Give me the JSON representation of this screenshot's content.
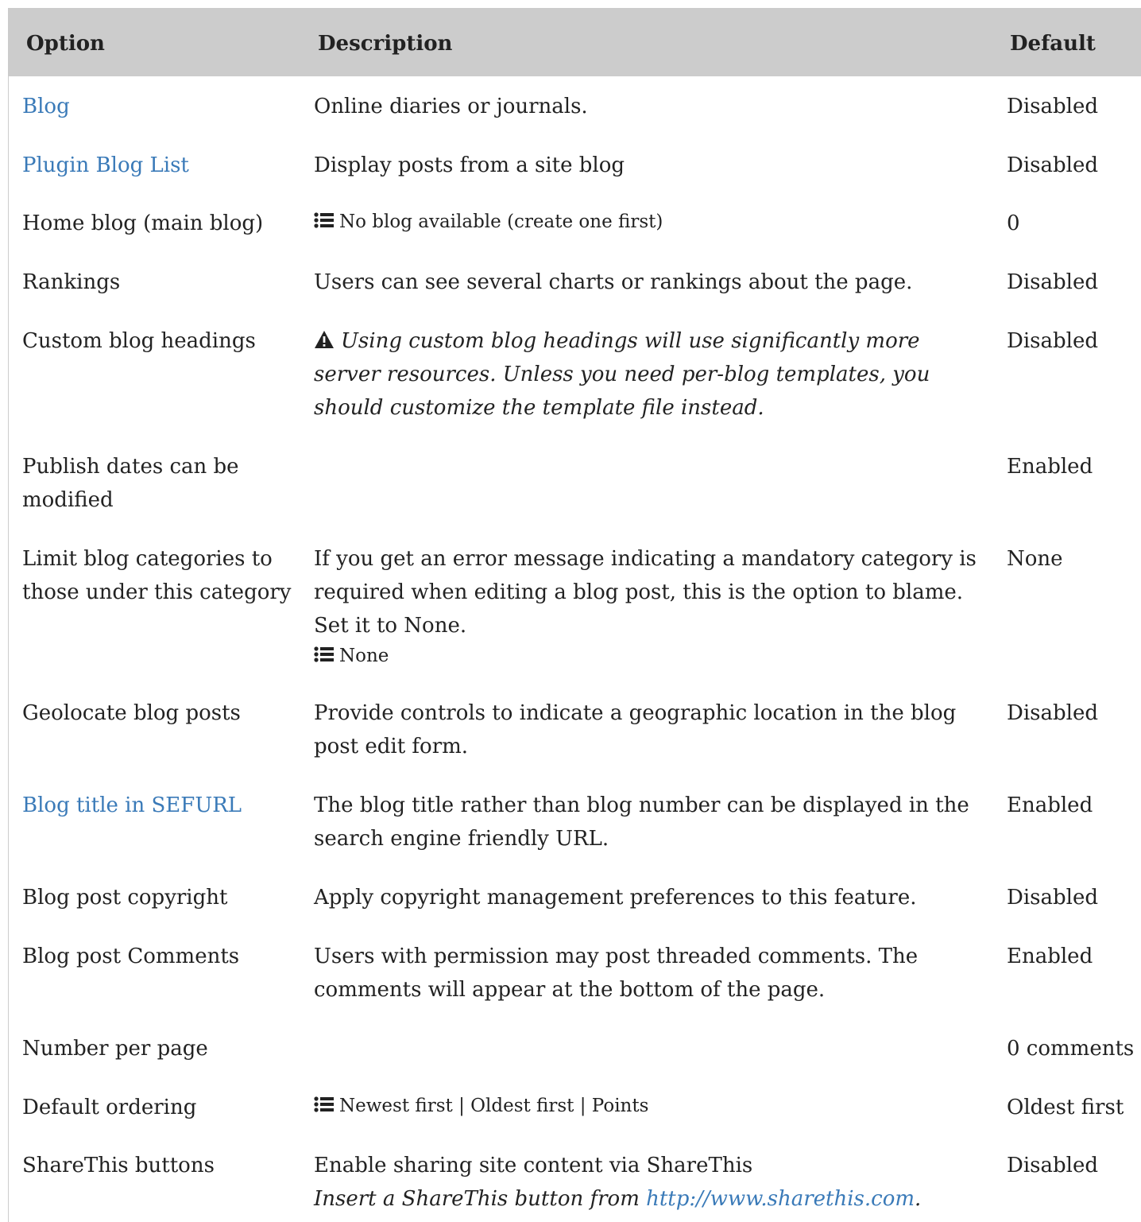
{
  "header": {
    "option": "Option",
    "description": "Description",
    "default": "Default"
  },
  "rows": [
    {
      "option": "Blog",
      "option_is_link": true,
      "description": "Online diaries or journals.",
      "default": "Disabled"
    },
    {
      "option": "Plugin Blog List",
      "option_is_link": true,
      "description": "Display posts from a site blog",
      "default": "Disabled"
    },
    {
      "option": "Home blog (main blog)",
      "description_list_icon": "list-icon",
      "description": "No blog available (create one first)",
      "default": "0"
    },
    {
      "option": "Rankings",
      "description": "Users can see several charts or rankings about the page.",
      "default": "Disabled"
    },
    {
      "option": "Custom blog headings",
      "description_warning_icon": "warning-icon",
      "description": "Using custom blog headings will use significantly more server resources. Unless you need per-blog templates, you should customize the template file instead.",
      "default": "Disabled"
    },
    {
      "option": "Publish dates can be modified",
      "description": "",
      "default": "Enabled"
    },
    {
      "option": "Limit blog categories to those under this category",
      "description": "If you get an error message indicating a mandatory category is required when editing a blog post, this is the option to blame. Set it to None.",
      "description_choices": "None",
      "default": "None"
    },
    {
      "option": "Geolocate blog posts",
      "description": "Provide controls to indicate a geographic location in the blog post edit form.",
      "default": "Disabled"
    },
    {
      "option": "Blog title in SEFURL",
      "option_is_link": true,
      "description": "The blog title rather than blog number can be displayed in the search engine friendly URL.",
      "default": "Enabled"
    },
    {
      "option": "Blog post copyright",
      "description": "Apply copyright management preferences to this feature.",
      "default": "Disabled"
    },
    {
      "option": "Blog post Comments",
      "description": "Users with permission may post threaded comments. The comments will appear at the bottom of the page.",
      "default": "Enabled"
    },
    {
      "option": "Number per page",
      "description": "",
      "default": "0 comments"
    },
    {
      "option": "Default ordering",
      "description_list_icon": "list-icon",
      "description": "Newest first | Oldest first | Points",
      "default": "Oldest first"
    },
    {
      "option": "ShareThis buttons",
      "description": "Enable sharing site content via ShareThis",
      "description_note_prefix": "Insert a ShareThis button from ",
      "description_note_link": "http://www.sharethis.com",
      "description_note_suffix": ".",
      "default": "Disabled"
    }
  ],
  "colors": {
    "header_bg": "#cccccc",
    "link": "#3a7ab8",
    "text": "#222222"
  }
}
